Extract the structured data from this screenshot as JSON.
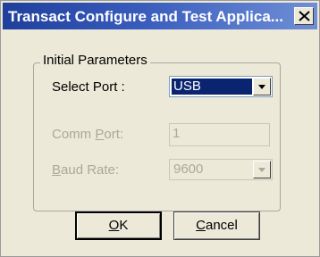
{
  "window": {
    "title": "Transact Configure and Test Applica...",
    "close_icon": "close-icon"
  },
  "group": {
    "title": "Initial Parameters"
  },
  "select_port": {
    "label_prefix": "Select Port :",
    "value": "USB",
    "enabled": true
  },
  "comm_port": {
    "label_before": "Comm ",
    "label_mnemonic": "P",
    "label_after": "ort:",
    "value": "1",
    "enabled": false
  },
  "baud_rate": {
    "label_mnemonic": "B",
    "label_after": "aud Rate:",
    "value": "9600",
    "enabled": false
  },
  "buttons": {
    "ok": {
      "mnemonic": "O",
      "rest": "K"
    },
    "cancel": {
      "mnemonic": "C",
      "rest": "ancel"
    }
  }
}
